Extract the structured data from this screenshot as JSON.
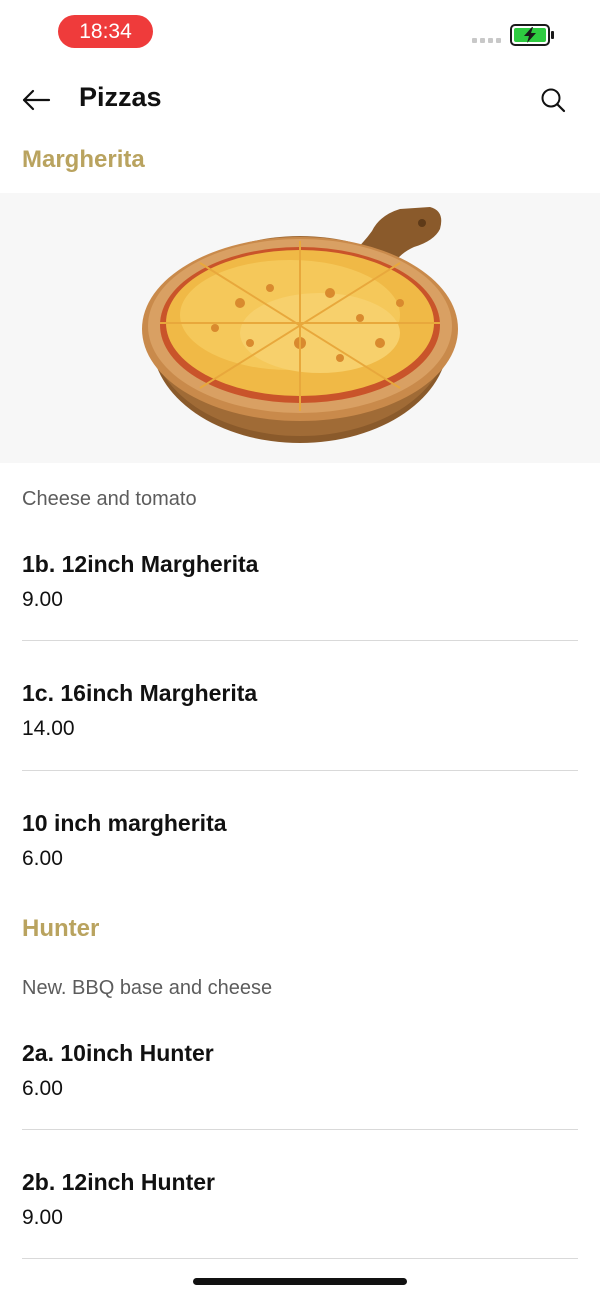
{
  "status_bar": {
    "time": "18:34",
    "time_pill_color": "#ef3b3b",
    "battery_color": "#2ecc40"
  },
  "nav": {
    "title": "Pizzas",
    "back_icon": "arrow-left-icon",
    "search_icon": "search-icon"
  },
  "sections": [
    {
      "title": "Margherita",
      "description": "Cheese and tomato",
      "image": "margherita-pizza-on-wooden-board",
      "items": [
        {
          "name": "1b. 12inch Margherita",
          "price": "9.00"
        },
        {
          "name": "1c. 16inch Margherita",
          "price": "14.00"
        },
        {
          "name": "10 inch margherita",
          "price": "6.00"
        }
      ]
    },
    {
      "title": "Hunter",
      "description": "New. BBQ base and cheese",
      "items": [
        {
          "name": "2a. 10inch Hunter",
          "price": "6.00"
        },
        {
          "name": "2b. 12inch Hunter",
          "price": "9.00"
        }
      ]
    }
  ],
  "accent_color": "#b9a35f"
}
